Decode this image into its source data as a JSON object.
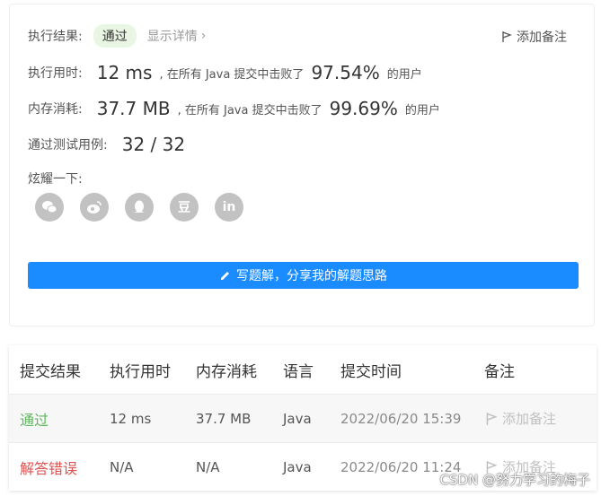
{
  "result_card": {
    "status_label": "执行结果:",
    "status_value": "通过",
    "details_link": "显示详情",
    "add_note": "添加备注",
    "runtime_label": "执行用时:",
    "runtime_value": "12 ms",
    "runtime_middle": ", 在所有 Java 提交中击败了",
    "runtime_pct": "97.54%",
    "runtime_suffix": "的用户",
    "memory_label": "内存消耗:",
    "memory_value": "37.7 MB",
    "memory_middle": ", 在所有 Java 提交中击败了",
    "memory_pct": "99.69%",
    "memory_suffix": "的用户",
    "tests_label": "通过测试用例:",
    "tests_value": "32 / 32",
    "share_label": "炫耀一下:",
    "share_icons": [
      "wechat-icon",
      "weibo-icon",
      "qq-icon",
      "douban-icon",
      "linkedin-icon"
    ],
    "douban_glyph": "豆",
    "linkedin_glyph": "in",
    "cta_label": "写题解，分享我的解题思路"
  },
  "table": {
    "headers": [
      "提交结果",
      "执行用时",
      "内存消耗",
      "语言",
      "提交时间",
      "备注"
    ],
    "rows": [
      {
        "result": "通过",
        "runtime": "12 ms",
        "memory": "37.7 MB",
        "lang": "Java",
        "time": "2022/06/20 15:39",
        "note": "添加备注"
      },
      {
        "result": "解答错误",
        "runtime": "N/A",
        "memory": "N/A",
        "lang": "Java",
        "time": "2022/06/20 11:24",
        "note": "添加备注"
      }
    ]
  },
  "watermark": "CSDN @努力学习的梅子",
  "colors": {
    "accent": "#1a8cff",
    "pass": "#5cb85c",
    "error": "#e05050"
  }
}
